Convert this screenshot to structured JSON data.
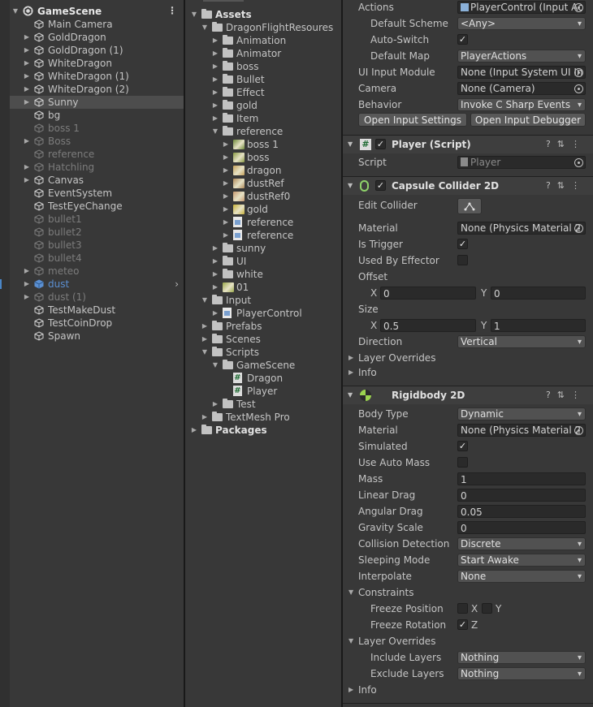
{
  "hierarchy": {
    "scene": "GameScene",
    "items": [
      {
        "name": "Main Camera",
        "state": "normal",
        "fold": false
      },
      {
        "name": "GoldDragon",
        "state": "normal",
        "fold": true
      },
      {
        "name": "GoldDragon (1)",
        "state": "normal",
        "fold": true
      },
      {
        "name": "WhiteDragon",
        "state": "normal",
        "fold": true
      },
      {
        "name": "WhiteDragon (1)",
        "state": "normal",
        "fold": true
      },
      {
        "name": "WhiteDragon (2)",
        "state": "normal",
        "fold": true
      },
      {
        "name": "Sunny",
        "state": "selected",
        "fold": true
      },
      {
        "name": "bg",
        "state": "normal",
        "fold": false
      },
      {
        "name": "boss 1",
        "state": "disabled",
        "fold": false
      },
      {
        "name": "Boss",
        "state": "disabled",
        "fold": true
      },
      {
        "name": "reference",
        "state": "disabled",
        "fold": false
      },
      {
        "name": "Hatchling",
        "state": "disabled",
        "fold": true
      },
      {
        "name": "Canvas",
        "state": "normal",
        "fold": true
      },
      {
        "name": "EventSystem",
        "state": "normal",
        "fold": false
      },
      {
        "name": "TestEyeChange",
        "state": "normal",
        "fold": false
      },
      {
        "name": "bullet1",
        "state": "disabled",
        "fold": false
      },
      {
        "name": "bullet2",
        "state": "disabled",
        "fold": false
      },
      {
        "name": "bullet3",
        "state": "disabled",
        "fold": false
      },
      {
        "name": "bullet4",
        "state": "disabled",
        "fold": false
      },
      {
        "name": "meteo",
        "state": "disabled",
        "fold": true
      },
      {
        "name": "dust",
        "state": "prefab",
        "fold": true
      },
      {
        "name": "dust (1)",
        "state": "disabled",
        "fold": true
      },
      {
        "name": "TestMakeDust",
        "state": "normal",
        "fold": false
      },
      {
        "name": "TestCoinDrop",
        "state": "normal",
        "fold": false
      },
      {
        "name": "Spawn",
        "state": "normal",
        "fold": false
      }
    ]
  },
  "project": {
    "items": [
      {
        "name": "Assets",
        "depth": 0,
        "icon": "folder",
        "fold": "open",
        "bold": true
      },
      {
        "name": "DragonFlightResoures",
        "depth": 1,
        "icon": "folder",
        "fold": "open"
      },
      {
        "name": "Animation",
        "depth": 2,
        "icon": "folder",
        "fold": "closed"
      },
      {
        "name": "Animator",
        "depth": 2,
        "icon": "folder",
        "fold": "closed"
      },
      {
        "name": "boss",
        "depth": 2,
        "icon": "folder",
        "fold": "closed"
      },
      {
        "name": "Bullet",
        "depth": 2,
        "icon": "folder",
        "fold": "closed"
      },
      {
        "name": "Effect",
        "depth": 2,
        "icon": "folder",
        "fold": "closed"
      },
      {
        "name": "gold",
        "depth": 2,
        "icon": "folder",
        "fold": "closed"
      },
      {
        "name": "Item",
        "depth": 2,
        "icon": "folder",
        "fold": "closed"
      },
      {
        "name": "reference",
        "depth": 2,
        "icon": "folder",
        "fold": "open"
      },
      {
        "name": "boss 1",
        "depth": 3,
        "icon": "sprite",
        "fold": "closed",
        "color": "#6f8a3a"
      },
      {
        "name": "boss",
        "depth": 3,
        "icon": "sprite",
        "fold": "closed",
        "color": "#8a9a44"
      },
      {
        "name": "dragon",
        "depth": 3,
        "icon": "sprite",
        "fold": "closed",
        "color": "#c7a25a"
      },
      {
        "name": "dustRef",
        "depth": 3,
        "icon": "sprite",
        "fold": "closed",
        "color": "#b08a5a"
      },
      {
        "name": "dustRef0",
        "depth": 3,
        "icon": "sprite",
        "fold": "closed",
        "color": "#c89a70"
      },
      {
        "name": "gold",
        "depth": 3,
        "icon": "sprite",
        "fold": "closed",
        "color": "#c9b23a"
      },
      {
        "name": "reference",
        "depth": 3,
        "icon": "doc",
        "fold": "closed"
      },
      {
        "name": "reference",
        "depth": 3,
        "icon": "doc",
        "fold": "closed"
      },
      {
        "name": "sunny",
        "depth": 2,
        "icon": "folder",
        "fold": "closed"
      },
      {
        "name": "UI",
        "depth": 2,
        "icon": "folder",
        "fold": "closed"
      },
      {
        "name": "white",
        "depth": 2,
        "icon": "folder",
        "fold": "closed"
      },
      {
        "name": "01",
        "depth": 2,
        "icon": "sprite",
        "fold": "closed",
        "color": "#9aa84a"
      },
      {
        "name": "Input",
        "depth": 1,
        "icon": "folder",
        "fold": "open"
      },
      {
        "name": "PlayerControl",
        "depth": 2,
        "icon": "doc",
        "fold": "closed"
      },
      {
        "name": "Prefabs",
        "depth": 1,
        "icon": "folder",
        "fold": "closed"
      },
      {
        "name": "Scenes",
        "depth": 1,
        "icon": "folder",
        "fold": "closed"
      },
      {
        "name": "Scripts",
        "depth": 1,
        "icon": "folder",
        "fold": "open"
      },
      {
        "name": "GameScene",
        "depth": 2,
        "icon": "folder",
        "fold": "open"
      },
      {
        "name": "Dragon",
        "depth": 3,
        "icon": "script",
        "fold": "none"
      },
      {
        "name": "Player",
        "depth": 3,
        "icon": "script",
        "fold": "none"
      },
      {
        "name": "Test",
        "depth": 2,
        "icon": "folder",
        "fold": "closed"
      },
      {
        "name": "TextMesh Pro",
        "depth": 1,
        "icon": "folder",
        "fold": "closed"
      },
      {
        "name": "Packages",
        "depth": 0,
        "icon": "folder",
        "fold": "closed",
        "bold": true
      }
    ]
  },
  "inspector": {
    "player_input": {
      "actions_label": "Actions",
      "actions_value": "PlayerControl (Input Ac",
      "default_scheme_label": "Default Scheme",
      "default_scheme_value": "<Any>",
      "auto_switch_label": "Auto-Switch",
      "default_map_label": "Default Map",
      "default_map_value": "PlayerActions",
      "ui_input_module_label": "UI Input Module",
      "ui_input_module_value": "None (Input System UI In",
      "camera_label": "Camera",
      "camera_value": "None (Camera)",
      "behavior_label": "Behavior",
      "behavior_value": "Invoke C Sharp Events",
      "open_input_settings": "Open Input Settings",
      "open_input_debugger": "Open Input Debugger"
    },
    "player_script": {
      "title": "Player (Script)",
      "script_label": "Script",
      "script_value": "Player"
    },
    "capsule": {
      "title": "Capsule Collider 2D",
      "edit_collider_label": "Edit Collider",
      "material_label": "Material",
      "material_value": "None (Physics Material 2",
      "is_trigger_label": "Is Trigger",
      "used_by_effector_label": "Used By Effector",
      "offset_label": "Offset",
      "offset_x": "0",
      "offset_y": "0",
      "size_label": "Size",
      "size_x": "0.5",
      "size_y": "1",
      "x": "X",
      "y": "Y",
      "direction_label": "Direction",
      "direction_value": "Vertical",
      "layer_overrides_label": "Layer Overrides",
      "info_label": "Info"
    },
    "rigidbody": {
      "title": "Rigidbody 2D",
      "body_type_label": "Body Type",
      "body_type_value": "Dynamic",
      "material_label": "Material",
      "material_value": "None (Physics Material 2",
      "simulated_label": "Simulated",
      "use_auto_mass_label": "Use Auto Mass",
      "mass_label": "Mass",
      "mass_value": "1",
      "linear_drag_label": "Linear Drag",
      "linear_drag_value": "0",
      "angular_drag_label": "Angular Drag",
      "angular_drag_value": "0.05",
      "gravity_scale_label": "Gravity Scale",
      "gravity_scale_value": "0",
      "collision_detection_label": "Collision Detection",
      "collision_detection_value": "Discrete",
      "sleeping_mode_label": "Sleeping Mode",
      "sleeping_mode_value": "Start Awake",
      "interpolate_label": "Interpolate",
      "interpolate_value": "None",
      "constraints_label": "Constraints",
      "freeze_position_label": "Freeze Position",
      "freeze_rotation_label": "Freeze Rotation",
      "x": "X",
      "y": "Y",
      "z": "Z",
      "layer_overrides_label": "Layer Overrides",
      "include_layers_label": "Include Layers",
      "include_layers_value": "Nothing",
      "exclude_layers_label": "Exclude Layers",
      "exclude_layers_value": "Nothing",
      "info_label": "Info"
    }
  }
}
